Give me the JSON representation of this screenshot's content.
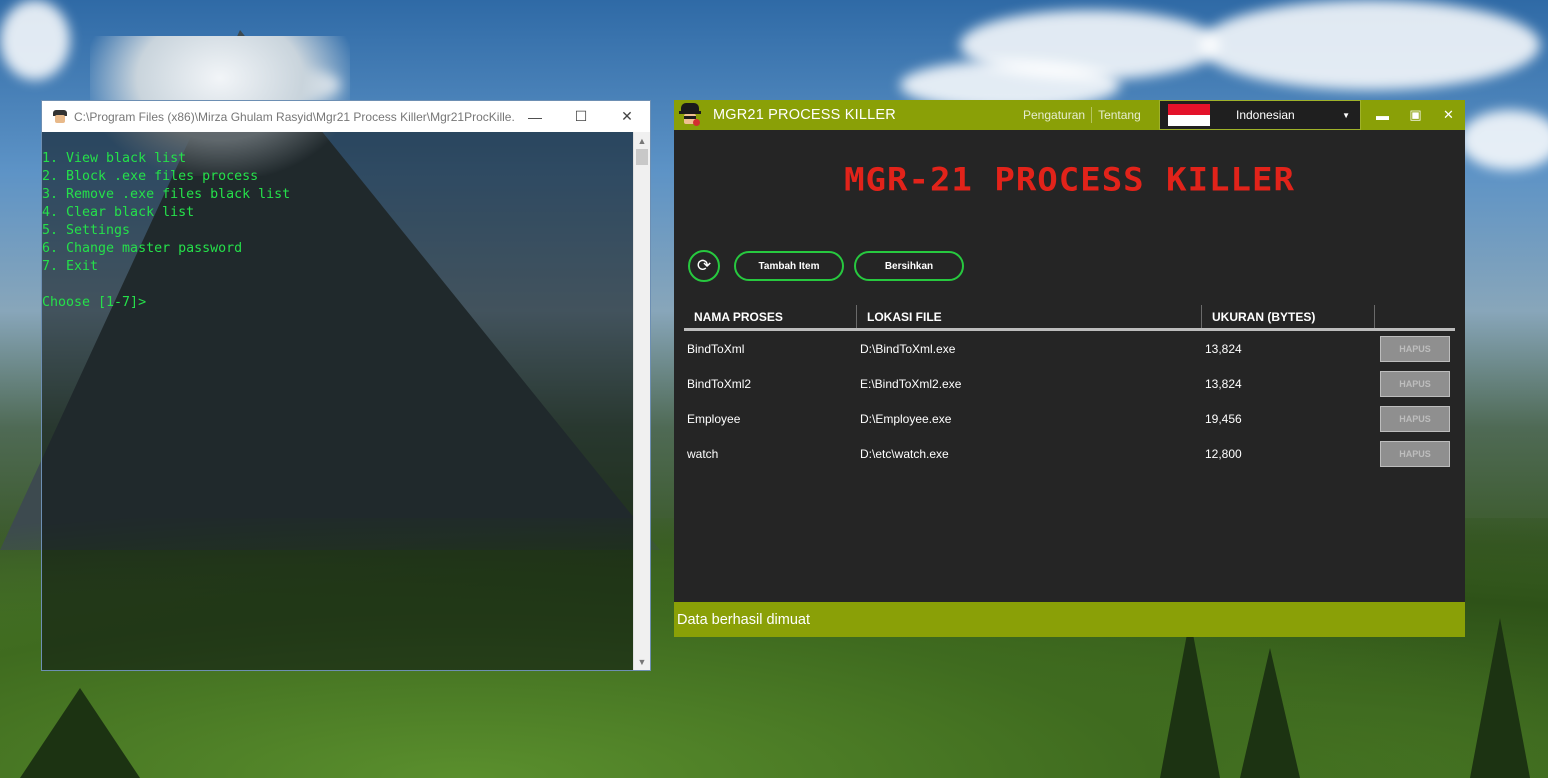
{
  "console": {
    "title": "C:\\Program Files (x86)\\Mirza Ghulam Rasyid\\Mgr21 Process Killer\\Mgr21ProcKille...",
    "lines": [
      "1. View black list",
      "2. Block .exe files process",
      "3. Remove .exe files black list",
      "4. Clear black list",
      "5. Settings",
      "6. Change master password",
      "7. Exit",
      "",
      "Choose [1-7]>"
    ],
    "text_color": "#25e04a"
  },
  "app": {
    "title": "MGR21 PROCESS KILLER",
    "menu": {
      "settings": "Pengaturan",
      "about": "Tentang"
    },
    "language": "Indonesian",
    "heading": "MGR-21 PROCESS KILLER",
    "buttons": {
      "add": "Tambah Item",
      "clear": "Bersihkan"
    },
    "table": {
      "columns": [
        "NAMA PROSES",
        "LOKASI FILE",
        "UKURAN (BYTES)",
        ""
      ],
      "delete_label": "HAPUS",
      "rows": [
        {
          "name": "BindToXml",
          "location": "D:\\BindToXml.exe",
          "size": "13,824"
        },
        {
          "name": "BindToXml2",
          "location": "E:\\BindToXml2.exe",
          "size": "13,824"
        },
        {
          "name": "Employee",
          "location": "D:\\Employee.exe",
          "size": "19,456"
        },
        {
          "name": "watch",
          "location": "D:\\etc\\watch.exe",
          "size": "12,800"
        }
      ]
    },
    "status": "Data berhasil dimuat",
    "colors": {
      "accent": "#8aa007",
      "heading": "#e2231a",
      "button_border": "#27c93f",
      "background": "#252525"
    }
  }
}
